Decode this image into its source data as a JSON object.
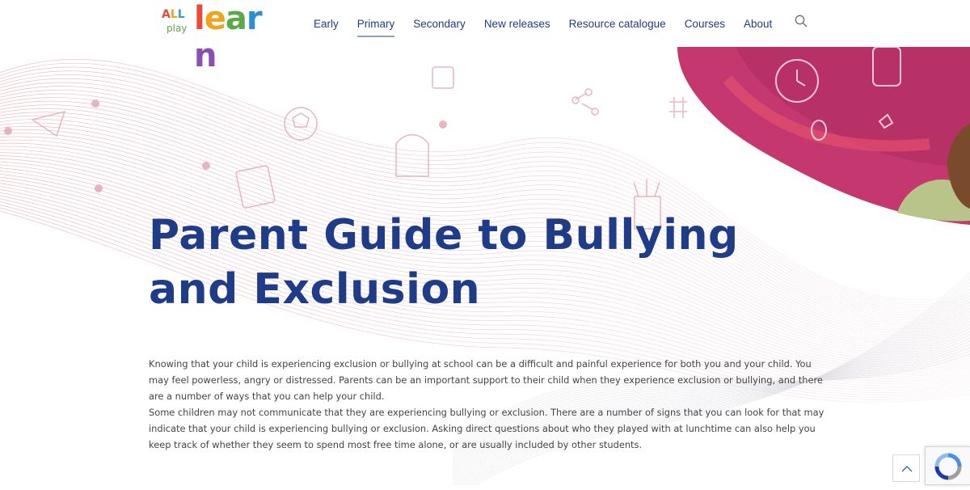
{
  "header": {
    "logo": {
      "all_text": "ALL",
      "play_text": "play",
      "learn_text": "learn",
      "all_colors": [
        "#e64b3b",
        "#f2a31c",
        "#3a9ad9"
      ],
      "learn_colors": [
        "#e64b3b",
        "#f2a31c",
        "#5aa847",
        "#2e8fd6",
        "#8b4fb3"
      ]
    },
    "nav": [
      {
        "label": "Early",
        "active": false
      },
      {
        "label": "Primary",
        "active": true
      },
      {
        "label": "Secondary",
        "active": false
      },
      {
        "label": "New releases",
        "active": false
      },
      {
        "label": "Resource catalogue",
        "active": false
      },
      {
        "label": "Courses",
        "active": false
      },
      {
        "label": "About",
        "active": false
      }
    ],
    "search_icon": "search-icon"
  },
  "hero": {
    "title_line1": "Parent Guide to Bullying",
    "title_line2": "and Exclusion",
    "accent_pink": "#e9a6b4",
    "banner_magenta": "#c4386f",
    "title_color": "#1f3c88"
  },
  "content": {
    "paragraph1": "Knowing that your child is experiencing exclusion or bullying at school can be a difficult and painful experience for both you and your child. You may feel powerless, angry or distressed. Parents can be an important support to their child when they experience exclusion or bullying, and there are a number of ways that you can help your child.",
    "paragraph2": "Some children may not communicate that they are experiencing bullying or exclusion. There are a number of signs that you can look for that may indicate that your child is experiencing bullying or exclusion. Asking direct questions about who they played with at lunchtime can also help you keep track of whether they seem to spend most free time alone, or are usually included by other students."
  },
  "widgets": {
    "scroll_top_icon": "chevron-up-icon",
    "recaptcha_icon": "recaptcha-icon"
  }
}
